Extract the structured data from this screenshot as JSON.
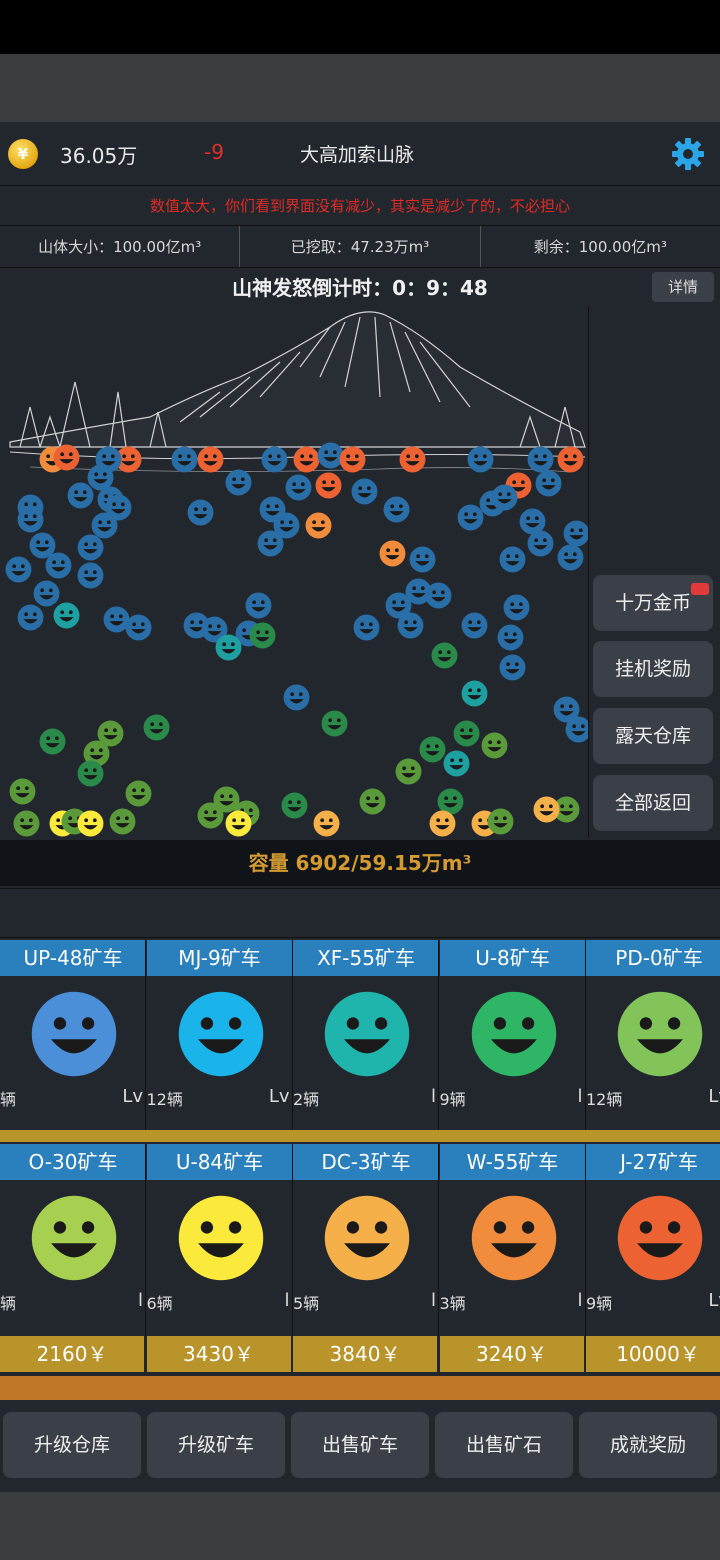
{
  "header": {
    "money": "36.05万",
    "delta": "-9",
    "title": "大高加索山脉",
    "coin_symbol": "¥",
    "settings_icon": "gear-icon"
  },
  "notice": "数值太大，你们看到界面没有减少，其实是减少了的，不必担心",
  "stats": {
    "size": "山体大小：100.00亿m³",
    "dug": "已挖取：47.23万m³",
    "remaining": "剩余：100.00亿m³"
  },
  "countdown": "山神发怒倒计时：0：9：48",
  "detail_button": "详情",
  "side_buttons": [
    "十万金币",
    "挂机奖励",
    "露天仓库",
    "全部返回"
  ],
  "capacity": "容量 6902/59.15万m³",
  "carts_row1": [
    {
      "name": "UP-48矿车",
      "count": "辆",
      "level": "Lv",
      "color": "#4a8fd8"
    },
    {
      "name": "MJ-9矿车",
      "count": "12辆",
      "level": "Lv",
      "color": "#1ab4ea"
    },
    {
      "name": "XF-55矿车",
      "count": "2辆",
      "level": "l",
      "color": "#1fb5ad"
    },
    {
      "name": "U-8矿车",
      "count": "9辆",
      "level": "l",
      "color": "#2eb565"
    },
    {
      "name": "PD-0矿车",
      "count": "12辆",
      "level": "Lv",
      "color": "#82c45a"
    }
  ],
  "carts_row2": [
    {
      "name": "O-30矿车",
      "count": "辆",
      "level": "l",
      "color": "#a8d050",
      "price": "2160￥"
    },
    {
      "name": "U-84矿车",
      "count": "6辆",
      "level": "l",
      "color": "#fbea3c",
      "price": "3430￥"
    },
    {
      "name": "DC-3矿车",
      "count": "5辆",
      "level": "l",
      "color": "#f6b04a",
      "price": "3840￥"
    },
    {
      "name": "W-55矿车",
      "count": "3辆",
      "level": "l",
      "color": "#f08c3c",
      "price": "3240￥"
    },
    {
      "name": "J-27矿车",
      "count": "9辆",
      "level": "Lv",
      "color": "#ec6232",
      "price": "10000￥"
    }
  ],
  "bottom_buttons": [
    "升级仓库",
    "升级矿车",
    "出售矿车",
    "出售矿石",
    "成就奖励"
  ],
  "colors": {
    "bg": "#22272e",
    "blue_head": "#2a7fbd",
    "gold": "#b8942a",
    "orange": "#c07828",
    "warning": "#e02a24"
  }
}
